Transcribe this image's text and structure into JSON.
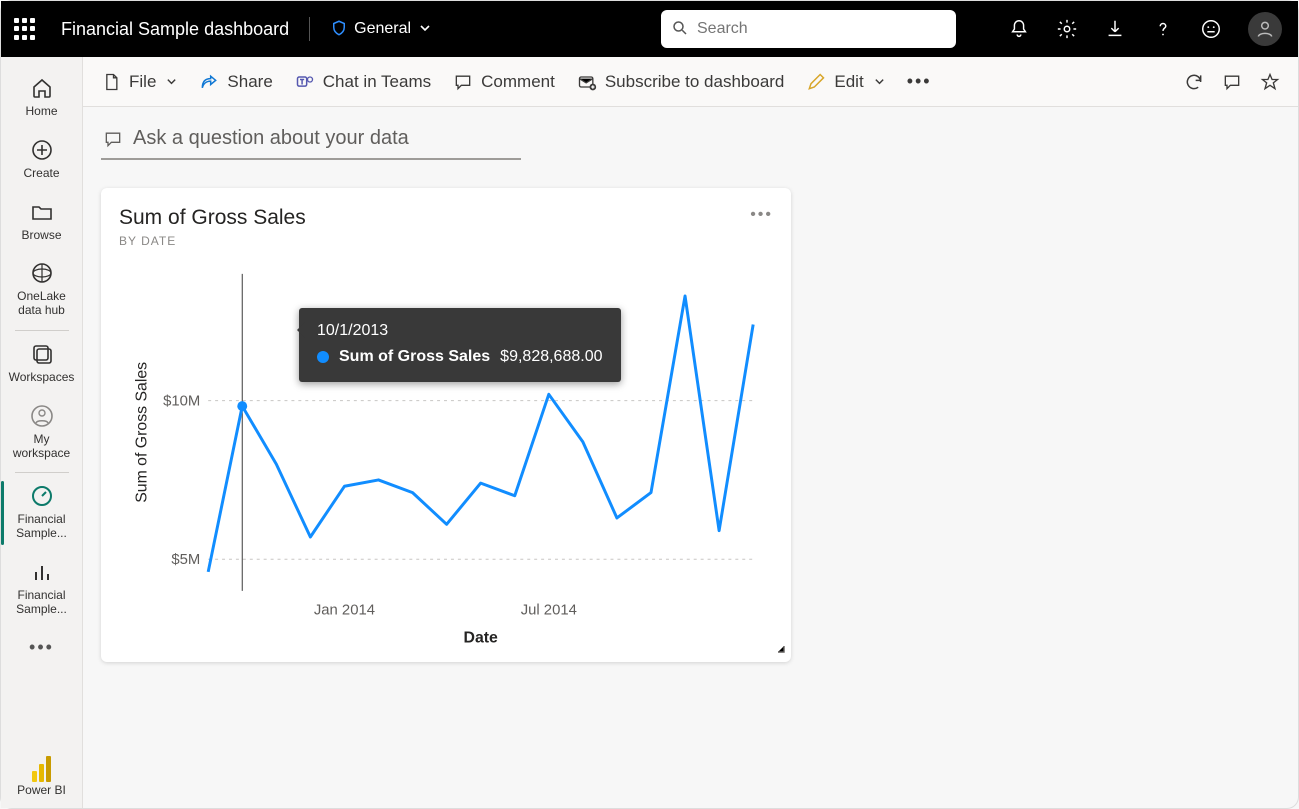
{
  "header": {
    "doc_title": "Financial Sample dashboard",
    "sensitivity_label": "General",
    "search_placeholder": "Search"
  },
  "leftnav": {
    "items": [
      {
        "key": "home",
        "label": "Home"
      },
      {
        "key": "create",
        "label": "Create"
      },
      {
        "key": "browse",
        "label": "Browse"
      },
      {
        "key": "onelake",
        "label": "OneLake data hub"
      },
      {
        "key": "workspaces",
        "label": "Workspaces"
      },
      {
        "key": "myws",
        "label": "My workspace"
      },
      {
        "key": "fin-dash",
        "label": "Financial Sample..."
      },
      {
        "key": "fin-rep",
        "label": "Financial Sample..."
      }
    ],
    "footer_label": "Power BI"
  },
  "cmdbar": {
    "file": "File",
    "share": "Share",
    "teams": "Chat in Teams",
    "comment": "Comment",
    "subscribe": "Subscribe to dashboard",
    "edit": "Edit"
  },
  "qna": {
    "placeholder": "Ask a question about your data"
  },
  "tile": {
    "title": "Sum of Gross Sales",
    "subtitle": "BY DATE"
  },
  "tooltip": {
    "date": "10/1/2013",
    "series": "Sum of Gross Sales",
    "value": "$9,828,688.00"
  },
  "chart_data": {
    "type": "line",
    "title": "Sum of Gross Sales by Date",
    "xlabel": "Date",
    "ylabel": "Sum of Gross Sales",
    "ylim": [
      4000000,
      14000000
    ],
    "y_ticks": [
      {
        "v": 5000000,
        "label": "$5M"
      },
      {
        "v": 10000000,
        "label": "$10M"
      }
    ],
    "x_ticks": [
      "Jan 2014",
      "Jul 2014"
    ],
    "x": [
      "2013-09",
      "2013-10",
      "2013-11",
      "2013-12",
      "2014-01",
      "2014-02",
      "2014-03",
      "2014-04",
      "2014-05",
      "2014-06",
      "2014-07",
      "2014-08",
      "2014-09",
      "2014-10",
      "2014-11",
      "2014-12"
    ],
    "values": [
      4600000,
      9828688,
      8000000,
      5700000,
      7300000,
      7500000,
      7100000,
      6100000,
      7400000,
      7000000,
      10200000,
      8700000,
      6300000,
      7100000,
      13300000,
      5900000,
      12400000
    ]
  }
}
